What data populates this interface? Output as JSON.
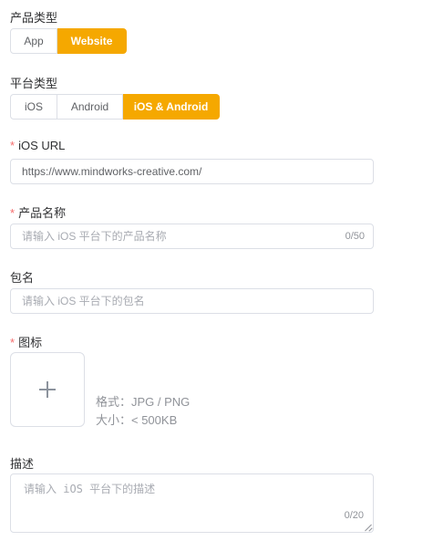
{
  "product_type": {
    "label": "产品类型",
    "options": [
      "App",
      "Website"
    ],
    "selected": "Website"
  },
  "platform_type": {
    "label": "平台类型",
    "options": [
      "iOS",
      "Android",
      "iOS & Android"
    ],
    "selected": "iOS & Android"
  },
  "ios_url": {
    "label": "iOS URL",
    "required": "*",
    "value": "https://www.mindworks-creative.com/"
  },
  "product_name": {
    "label": "产品名称",
    "required": "*",
    "placeholder": "请输入 iOS 平台下的产品名称",
    "count": "0/50"
  },
  "package_name": {
    "label": "包名",
    "placeholder": "请输入 iOS 平台下的包名"
  },
  "icon": {
    "label": "图标",
    "required": "*",
    "format_hint": "格式：JPG / PNG",
    "size_hint": "大小：< 500KB"
  },
  "description": {
    "label": "描述",
    "placeholder": "请输入 iOS 平台下的描述",
    "count": "0/20"
  },
  "colors": {
    "accent": "#f5a800",
    "required": "#f56c6c"
  }
}
